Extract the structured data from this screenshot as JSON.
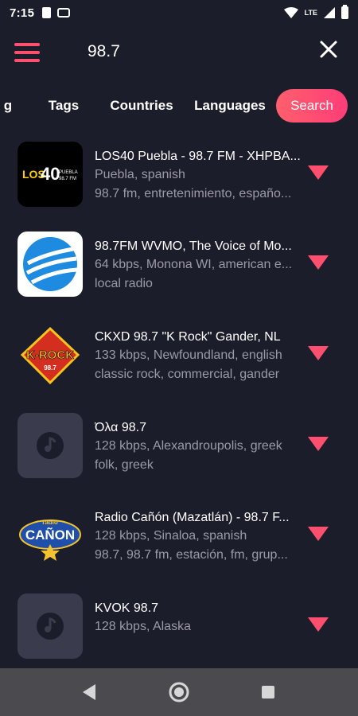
{
  "status_bar": {
    "time": "7:15",
    "network": "LTE",
    "icons": [
      "sim-icon",
      "voicemail-icon",
      "wifi-icon",
      "signal-icon",
      "battery-icon"
    ]
  },
  "app_bar": {
    "search_query": "98.7",
    "menu_icon": "hamburger-menu-icon",
    "close_icon": "close-icon"
  },
  "tabs": {
    "partial": "g",
    "tags": "Tags",
    "countries": "Countries",
    "languages": "Languages",
    "search": "Search"
  },
  "stations": [
    {
      "title": "LOS40 Puebla - 98.7 FM - XHPBA...",
      "line1": "Puebla, spanish",
      "line2": "98.7 fm, entretenimiento, españo..."
    },
    {
      "title": "98.7FM WVMO, The Voice of Mo...",
      "line1": "64 kbps, Monona WI, american e...",
      "line2": "local radio"
    },
    {
      "title": "CKXD 98.7 \"K Rock\"  Gander, NL",
      "line1": "133 kbps, Newfoundland, english",
      "line2": "classic rock, commercial, gander"
    },
    {
      "title": "Όλα 98.7",
      "line1": "128 kbps, Alexandroupolis, greek",
      "line2": "folk, greek"
    },
    {
      "title": "Radio Cañón (Mazatlán) - 98.7 F...",
      "line1": "128 kbps, Sinaloa, spanish",
      "line2": "98.7, 98.7 fm, estación, fm, grup..."
    },
    {
      "title": "KVOK 98.7",
      "line1": "128 kbps, Alaska",
      "line2": ""
    }
  ],
  "logos": {
    "los40_main": "LOS",
    "los40_num": "40",
    "los40_sub1": "PUEBLA",
    "los40_sub2": "98.7 FM",
    "krock": "K-ROCK",
    "krock_num": "98.7",
    "canon_top": "radio",
    "canon_main": "CAÑON"
  },
  "colors": {
    "background": "#1c1d2b",
    "accent": "#ff4f6e",
    "secondary_text": "#9a9aa8",
    "nav_bar": "#4b4b4f"
  }
}
